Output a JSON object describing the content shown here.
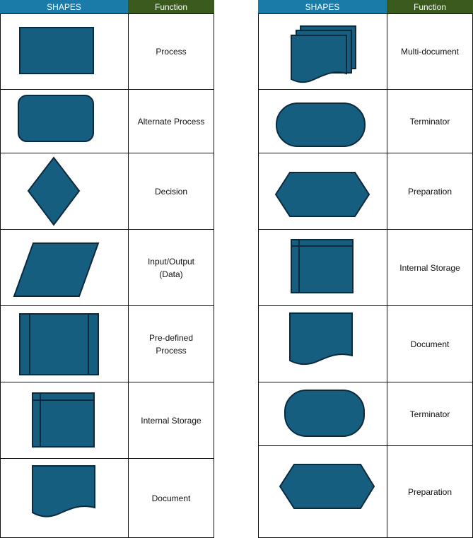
{
  "colors": {
    "shapes_header": "#1a7aa8",
    "function_header": "#3a5a1e",
    "shape_fill": "#155e80",
    "shape_stroke": "#0c2a3e"
  },
  "left": {
    "header_shapes": "SHAPES",
    "header_function": "Function",
    "rows": [
      {
        "shape": "process",
        "label": "Process"
      },
      {
        "shape": "alternate-process",
        "label": "Alternate Process"
      },
      {
        "shape": "decision",
        "label": "Decision"
      },
      {
        "shape": "input-output",
        "label": "Input/Output\n(Data)"
      },
      {
        "shape": "predefined-process",
        "label": "Pre-defined\nProcess"
      },
      {
        "shape": "internal-storage",
        "label": "Internal Storage"
      },
      {
        "shape": "document",
        "label": "Document"
      }
    ]
  },
  "right": {
    "header_shapes": "SHAPES",
    "header_function": "Function",
    "rows": [
      {
        "shape": "multi-document",
        "label": "Multi-document"
      },
      {
        "shape": "terminator",
        "label": "Terminator"
      },
      {
        "shape": "preparation",
        "label": "Preparation"
      },
      {
        "shape": "internal-storage",
        "label": "Internal Storage"
      },
      {
        "shape": "document",
        "label": "Document"
      },
      {
        "shape": "terminator",
        "label": "Terminator"
      },
      {
        "shape": "preparation",
        "label": "Preparation"
      }
    ]
  }
}
